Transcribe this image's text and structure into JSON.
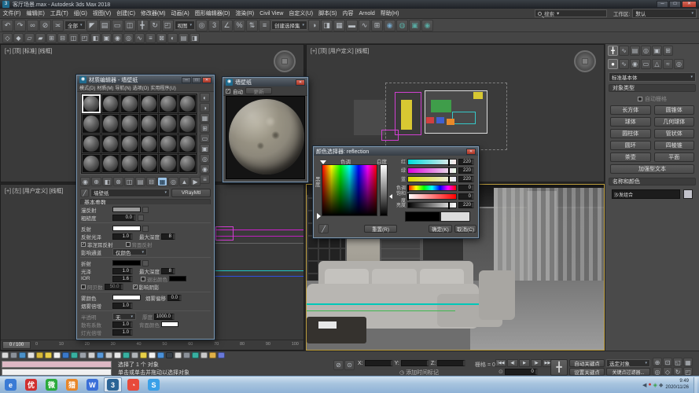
{
  "window": {
    "app_glyph": "3",
    "title": "客厅场景.max - Autodesk 3ds Max 2018",
    "min": "─",
    "max": "□",
    "close": "✕"
  },
  "menu_bar": {
    "items": [
      "文件(F)",
      "编辑(E)",
      "工具(T)",
      "组(G)",
      "视图(V)",
      "创建(C)",
      "修改器(M)",
      "动画(A)",
      "图形编辑器(D)",
      "渲染(R)",
      "Civil View",
      "自定义(U)",
      "脚本(S)",
      "内容",
      "Arnold",
      "帮助(H)"
    ],
    "search_label": "搜索",
    "workspace_label": "工作区:",
    "workspace_value": "默认"
  },
  "toolbar": {
    "row1": [
      {
        "t": "i",
        "items": [
          {
            "n": "undo-icon",
            "g": "↶"
          },
          {
            "n": "redo-icon",
            "g": "↷"
          },
          {
            "n": "select-link-icon",
            "g": "∞"
          },
          {
            "n": "unlink-icon",
            "g": "⊘"
          },
          {
            "n": "bind-spacewarp-icon",
            "g": "≍"
          }
        ]
      },
      {
        "t": "d",
        "v": "全部",
        "n": "selection-filter-dropdown"
      },
      {
        "t": "i",
        "items": [
          {
            "n": "select-icon",
            "g": "◤"
          },
          {
            "n": "select-by-name-icon",
            "g": "▤"
          },
          {
            "n": "rect-region-icon",
            "g": "▭"
          },
          {
            "n": "window-crossing-icon",
            "g": "◫"
          },
          {
            "n": "move-icon",
            "g": "╋"
          },
          {
            "n": "rotate-icon",
            "g": "↻"
          },
          {
            "n": "scale-icon",
            "g": "◰"
          }
        ]
      },
      {
        "t": "d",
        "v": "视图",
        "n": "reference-coordinate-dropdown"
      },
      {
        "t": "i",
        "items": [
          {
            "n": "use-center-icon",
            "g": "◎"
          },
          {
            "n": "snap-toggle-icon",
            "g": "3"
          },
          {
            "n": "angle-snap-icon",
            "g": "∠"
          },
          {
            "n": "percent-snap-icon",
            "g": "%"
          },
          {
            "n": "spinner-snap-icon",
            "g": "⇅"
          },
          {
            "n": "edit-named-selection-icon",
            "g": "≡"
          }
        ]
      },
      {
        "t": "d",
        "v": "创建选择集",
        "n": "named-selection-dropdown"
      },
      {
        "t": "i",
        "items": [
          {
            "n": "mirror-icon",
            "g": "◑"
          },
          {
            "n": "align-icon",
            "g": "◨"
          },
          {
            "n": "layer-manager-icon",
            "g": "▦"
          },
          {
            "n": "ribbon-icon",
            "g": "▬"
          },
          {
            "n": "curve-editor-icon",
            "g": "∿"
          },
          {
            "n": "schematic-view-icon",
            "g": "⊞"
          },
          {
            "n": "material-editor-icon",
            "g": "◉",
            "c": "#74a6c8"
          },
          {
            "n": "render-setup-icon",
            "g": "◍",
            "c": "#58a8a0"
          },
          {
            "n": "rendered-frame-icon",
            "g": "▣",
            "c": "#58a8a0"
          },
          {
            "n": "render-production-icon",
            "g": "◉",
            "c": "#58a8a0"
          }
        ]
      }
    ],
    "row2": [
      {
        "g": "◇"
      },
      {
        "g": "◆"
      },
      {
        "g": "▱"
      },
      {
        "g": "▰"
      },
      {
        "g": "⊞"
      },
      {
        "g": "⊟"
      },
      {
        "g": "◫"
      },
      {
        "g": "◰"
      },
      {
        "g": "◧"
      },
      {
        "g": "▣"
      },
      {
        "g": "◉"
      },
      {
        "g": "◎"
      },
      {
        "g": "∿"
      },
      {
        "g": "≡"
      },
      {
        "g": "⊠"
      },
      {
        "g": "◐"
      },
      {
        "g": "▤"
      },
      {
        "g": "◨"
      }
    ]
  },
  "viewports": {
    "top_left_label": "[+] [顶] [标准] [线框]",
    "top_right_label": "[+] [顶] [用户定义] [线框]",
    "bottom_left_label": "[+] [左] [用户定义] [线框]",
    "time_handle": "0 / 100",
    "ticks": [
      "0",
      "10",
      "20",
      "30",
      "40",
      "50",
      "60",
      "70",
      "80",
      "90",
      "100"
    ]
  },
  "material_editor": {
    "title": "材质编辑器 - 墙壁纸",
    "menus": [
      "模式(D)",
      "材质(M)",
      "导航(N)",
      "选项(O)",
      "实用程序(U)"
    ],
    "side_tools": [
      {
        "n": "sample-type-icon",
        "g": "◐"
      },
      {
        "n": "backlight-icon",
        "g": "◑"
      },
      {
        "n": "background-icon",
        "g": "▦"
      },
      {
        "n": "sample-tiling-icon",
        "g": "⊞"
      },
      {
        "n": "video-color-check-icon",
        "g": "▭"
      },
      {
        "n": "generate-preview-icon",
        "g": "▣"
      },
      {
        "n": "options-icon",
        "g": "◎"
      },
      {
        "n": "select-by-material-icon",
        "g": "◉"
      },
      {
        "n": "material-map-navigator-icon",
        "g": "≡"
      }
    ],
    "bottom_tools": [
      {
        "n": "get-material-icon",
        "g": "◉"
      },
      {
        "n": "put-material-icon",
        "g": "⊕"
      },
      {
        "n": "assign-material-icon",
        "g": "◧"
      },
      {
        "n": "reset-material-icon",
        "g": "⊗"
      },
      {
        "n": "make-unique-icon",
        "g": "◫"
      },
      {
        "n": "put-to-library-icon",
        "g": "▤"
      },
      {
        "n": "material-id-icon",
        "g": "⊟"
      },
      {
        "n": "show-map-viewport-icon",
        "g": "▦",
        "c": "#9cc4e8"
      },
      {
        "n": "show-end-result-icon",
        "g": "◎"
      },
      {
        "n": "go-parent-icon",
        "g": "▲"
      },
      {
        "n": "go-sibling-icon",
        "g": "▶"
      }
    ],
    "material_name": "墙壁纸",
    "material_type": "VRayMtl",
    "rollout_title": "基本参数",
    "params": {
      "diffuse_label": "漫反射",
      "roughness_label": "粗糙度",
      "roughness_value": "0.0",
      "reflect_label": "反射",
      "reflect_gloss_label": "反射光泽",
      "reflect_gloss_value": "1.0",
      "max_depth_label": "最大深度",
      "max_depth_value": "8",
      "fresnel_label": "菲涅耳反射",
      "backface_label": "背面反射",
      "affect_channels_label": "影响通道",
      "affect_channels_value": "仅颜色",
      "refract_label": "折射",
      "gloss_label": "光泽",
      "gloss_value": "1.0",
      "ior_label": "IOR",
      "ior_value": "1.6",
      "refract_depth_value": "8",
      "abbe_label": "阿贝数",
      "abbe_value": "50.0",
      "exit_color_label": "退出颜色",
      "affect_shadows_label": "影响阴影",
      "fog_label": "雾颜色",
      "fog_bias_label": "烟雾偏移",
      "fog_bias_value": "0.0",
      "fog_mult_label": "烟雾倍增",
      "fog_mult_value": "1.0",
      "translucency_label": "半透明",
      "translucency_value": "无",
      "thickness_label": "厚度",
      "thickness_value": "1000.0",
      "scatter_label": "散布系数",
      "scatter_value": "1.0",
      "back_color_label": "背面颜色",
      "light_mult_label": "灯光倍增",
      "light_mult_value": "1.0"
    }
  },
  "preview_window": {
    "title": "墙壁纸",
    "auto_label": "自动",
    "update_label": "更新"
  },
  "color_selector": {
    "title": "颜色选择器: reflection",
    "hue_label": "色调",
    "whiteness_label": "白度",
    "blackness_label": "黑度",
    "sliders": [
      {
        "label": "红",
        "value": "220",
        "g": "r",
        "pos": 86
      },
      {
        "label": "绿",
        "value": "220",
        "g": "g",
        "pos": 86
      },
      {
        "label": "蓝",
        "value": "220",
        "g": "b",
        "pos": 86
      },
      {
        "label": "色调",
        "value": "0",
        "g": "h",
        "pos": 0
      },
      {
        "label": "饱和度",
        "value": "0",
        "g": "s",
        "pos": 0
      },
      {
        "label": "亮度",
        "value": "220",
        "g": "v",
        "pos": 86
      }
    ],
    "old_color": "#000000",
    "new_color": "#dcdcdc",
    "reset_button": "重置(R)",
    "ok_button": "确定(K)",
    "cancel_button": "取消(C)"
  },
  "command_panel": {
    "tabs": [
      {
        "n": "tab-create",
        "g": "╋"
      },
      {
        "n": "tab-modify",
        "g": "∿"
      },
      {
        "n": "tab-hierarchy",
        "g": "▤"
      },
      {
        "n": "tab-motion",
        "g": "◎"
      },
      {
        "n": "tab-display",
        "g": "▣"
      },
      {
        "n": "tab-utilities",
        "g": "⊞"
      }
    ],
    "categories": [
      {
        "n": "cat-geometry",
        "g": "●"
      },
      {
        "n": "cat-shapes",
        "g": "∿"
      },
      {
        "n": "cat-lights",
        "g": "◉"
      },
      {
        "n": "cat-cameras",
        "g": "▭"
      },
      {
        "n": "cat-helpers",
        "g": "△"
      },
      {
        "n": "cat-spacewarps",
        "g": "≈"
      },
      {
        "n": "cat-systems",
        "g": "◎"
      }
    ],
    "dropdown_value": "标准基本体",
    "rollout_object_type": "对象类型",
    "autogrid_label": "自动栅格",
    "object_buttons": [
      "长方体",
      "圆锥体",
      "球体",
      "几何球体",
      "圆柱体",
      "管状体",
      "圆环",
      "四棱锥",
      "茶壶",
      "平面"
    ],
    "wide_button": "加强型文本",
    "rollout_name_color": "名称和颜色",
    "object_name": "沙发组合"
  },
  "status_bar": {
    "selection_text": "选择了 1 个 对象",
    "prompt_text": "单击或单击并拖动以选择对象",
    "isolate_icons": [
      {
        "n": "isolate-selection-icon",
        "g": "⊘"
      },
      {
        "n": "selection-lock-icon",
        "g": "⊙"
      }
    ],
    "x_label": "X:",
    "y_label": "Y:",
    "z_label": "Z:",
    "grid_text": "栅格 = 0.0",
    "time_tag_icon": "◷",
    "time_tag_text": "添加时间标记",
    "playback": [
      {
        "n": "go-start-button",
        "g": "|◀◀"
      },
      {
        "n": "prev-frame-button",
        "g": "◀|"
      },
      {
        "n": "play-button",
        "g": "▶"
      },
      {
        "n": "next-frame-button",
        "g": "|▶"
      },
      {
        "n": "go-end-button",
        "g": "▶▶|"
      }
    ],
    "key_toggle_glyph": "⊙",
    "frame_value": "0",
    "big_key_glyph": "╋",
    "auto_key": "自动关键点",
    "set_key": "设置关键点",
    "selected_dropdown": "选定对象",
    "key_filters": "关键点过滤器...",
    "nav": [
      {
        "n": "zoom-icon",
        "g": "⊕"
      },
      {
        "n": "zoom-all-icon",
        "g": "⊡"
      },
      {
        "n": "zoom-extents-icon",
        "g": "◱"
      },
      {
        "n": "zoom-extents-all-icon",
        "g": "▦"
      },
      {
        "n": "fov-icon",
        "g": "◎"
      },
      {
        "n": "pan-icon",
        "g": "◇"
      },
      {
        "n": "orbit-icon",
        "g": "↻"
      },
      {
        "n": "maximize-viewport-icon",
        "g": "◰"
      }
    ]
  },
  "plugin_bar": {
    "icons": [
      {
        "c": "#d8d8d8"
      },
      {
        "c": "#8a9098"
      },
      {
        "c": "#4a90c8"
      },
      {
        "c": "#e0e0e0"
      },
      {
        "c": "#d8b838"
      },
      {
        "c": "#e8cc48"
      },
      {
        "c": "#f0f0f0"
      },
      {
        "c": "#3a78c8"
      },
      {
        "c": "#38b0a0"
      },
      {
        "c": "#9aa0a8"
      },
      {
        "c": "#d0d0d0"
      },
      {
        "c": "#5898d8"
      },
      {
        "c": "#c8c8c8"
      },
      {
        "c": "#e8e8e8"
      },
      {
        "c": "#38b0a0"
      },
      {
        "c": "#b0b4b8"
      },
      {
        "c": "#e8d048"
      },
      {
        "c": "#f0f0f0"
      },
      {
        "c": "#4a90d8"
      },
      {
        "c": "#384048"
      },
      {
        "c": "#d8d8d8"
      },
      {
        "c": "#8a9098"
      },
      {
        "c": "#38b0a0"
      },
      {
        "c": "#c8c8c8"
      },
      {
        "c": "#e0b048"
      },
      {
        "c": "#6878d8"
      }
    ]
  },
  "taskbar": {
    "apps": [
      {
        "n": "taskbar-browser-icon",
        "g": "e",
        "c": "#3a7bd5"
      },
      {
        "n": "taskbar-youku-icon",
        "g": "优",
        "c": "#d03030"
      },
      {
        "n": "taskbar-wechat-icon",
        "g": "微",
        "c": "#2bab3c"
      },
      {
        "n": "taskbar-downloader-icon",
        "g": "猎",
        "c": "#e8872a"
      },
      {
        "n": "taskbar-wps-icon",
        "g": "W",
        "c": "#3a6fd8"
      },
      {
        "n": "taskbar-3dsmax-icon",
        "g": "3",
        "c": "#2a6496",
        "active": true
      },
      {
        "n": "taskbar-colorful-browser-icon",
        "g": "◔",
        "c": "#e84a3a"
      },
      {
        "n": "taskbar-sogou-icon",
        "g": "S",
        "c": "#3aa0e8"
      }
    ],
    "tray_icons": [
      {
        "n": "tray-expand-icon",
        "g": "◀",
        "c": "#405060"
      },
      {
        "n": "tray-red-icon",
        "g": "●",
        "c": "#c83a3a"
      },
      {
        "n": "tray-green-icon",
        "g": "◈",
        "c": "#38a048"
      },
      {
        "n": "tray-volume-icon",
        "g": "◆",
        "c": "#506070"
      }
    ],
    "tray_time": "9:49",
    "tray_date": "2020/11/26"
  }
}
